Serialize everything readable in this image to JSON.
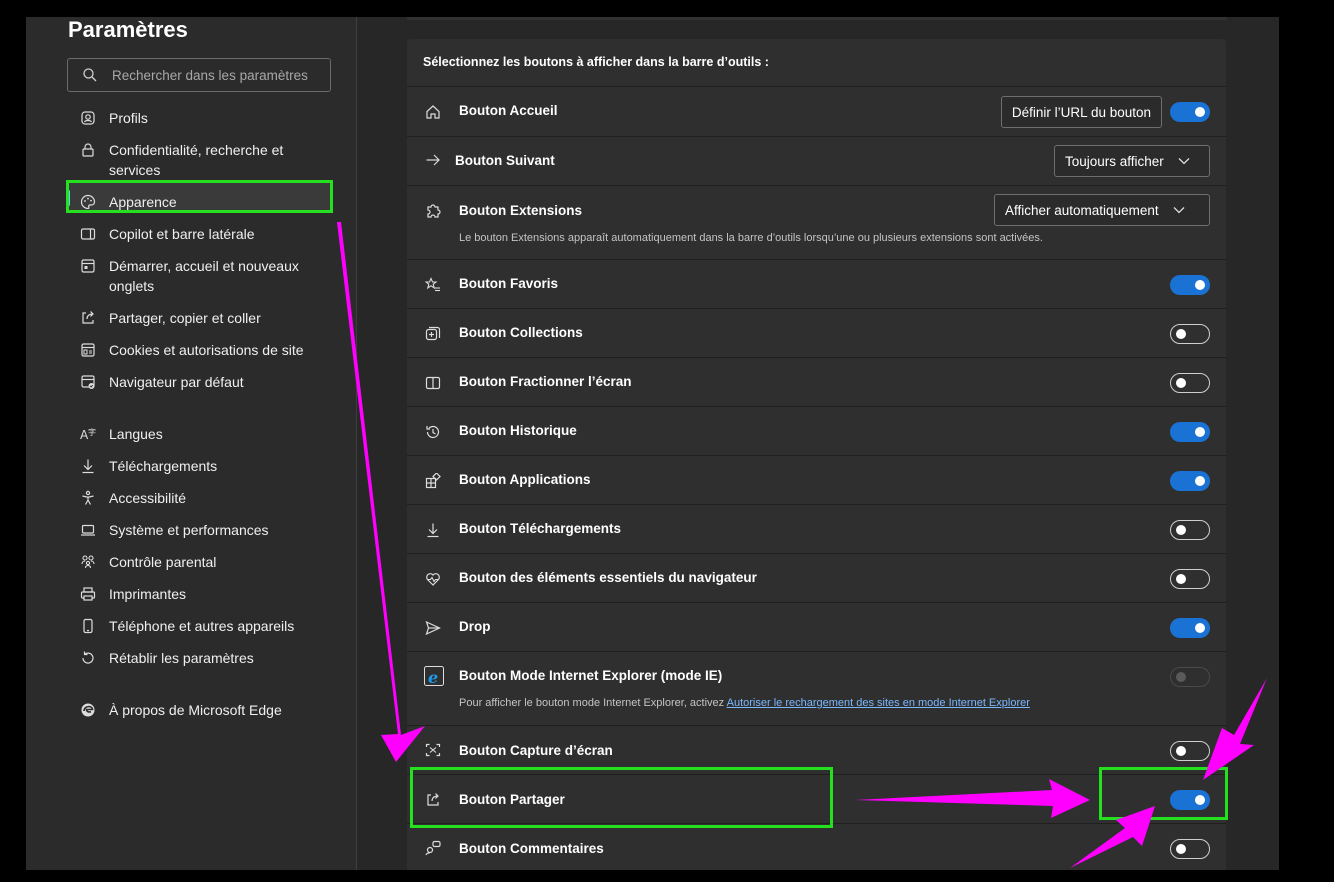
{
  "sidebar": {
    "title": "Paramètres",
    "search_placeholder": "Rechercher dans les paramètres",
    "items": [
      {
        "label": "Profils",
        "icon": "profile-icon"
      },
      {
        "label": "Confidentialité, recherche et services",
        "icon": "lock-icon"
      },
      {
        "label": "Apparence",
        "icon": "palette-icon",
        "active": true
      },
      {
        "label": "Copilot et barre latérale",
        "icon": "sidebar-icon"
      },
      {
        "label": "Démarrer, accueil et nouveaux onglets",
        "icon": "new-tab-icon"
      },
      {
        "label": "Partager, copier et coller",
        "icon": "share-icon"
      },
      {
        "label": "Cookies et autorisations de site",
        "icon": "cookie-icon"
      },
      {
        "label": "Navigateur par défaut",
        "icon": "default-browser-icon"
      },
      {
        "label": "Langues",
        "icon": "language-icon"
      },
      {
        "label": "Téléchargements",
        "icon": "download-icon"
      },
      {
        "label": "Accessibilité",
        "icon": "accessibility-icon"
      },
      {
        "label": "Système et performances",
        "icon": "laptop-icon"
      },
      {
        "label": "Contrôle parental",
        "icon": "family-icon"
      },
      {
        "label": "Imprimantes",
        "icon": "printer-icon"
      },
      {
        "label": "Téléphone et autres appareils",
        "icon": "phone-icon"
      },
      {
        "label": "Rétablir les paramètres",
        "icon": "reset-icon"
      },
      {
        "label": "À propos de Microsoft Edge",
        "icon": "edge-icon"
      }
    ]
  },
  "main": {
    "section_title": "Sélectionnez les boutons à afficher dans la barre d’outils :",
    "rows": [
      {
        "label": "Bouton Accueil",
        "icon": "home-icon",
        "button": "Définir l’URL du bouton",
        "toggle": "on"
      },
      {
        "label": "Bouton Suivant",
        "icon": "arrow-right-icon",
        "dropdown": "Toujours afficher"
      },
      {
        "label": "Bouton Extensions",
        "icon": "puzzle-icon",
        "dropdown": "Afficher automatiquement",
        "description": "Le bouton Extensions apparaît automatiquement dans la barre d’outils lorsqu’une ou plusieurs extensions sont activées."
      },
      {
        "label": "Bouton Favoris",
        "icon": "star-list-icon",
        "toggle": "on"
      },
      {
        "label": "Bouton Collections",
        "icon": "collections-icon",
        "toggle": "off"
      },
      {
        "label": "Bouton Fractionner l’écran",
        "icon": "split-screen-icon",
        "toggle": "off"
      },
      {
        "label": "Bouton Historique",
        "icon": "history-icon",
        "toggle": "on"
      },
      {
        "label": "Bouton Applications",
        "icon": "apps-icon",
        "toggle": "on"
      },
      {
        "label": "Bouton Téléchargements",
        "icon": "download-icon",
        "toggle": "off"
      },
      {
        "label": "Bouton des éléments essentiels du navigateur",
        "icon": "heart-pulse-icon",
        "toggle": "off"
      },
      {
        "label": "Drop",
        "icon": "send-icon",
        "toggle": "on"
      },
      {
        "label": "Bouton Mode Internet Explorer (mode IE)",
        "icon": "ie-icon",
        "toggle": "disabled",
        "description": "Pour afficher le bouton mode Internet Explorer, activez ",
        "link": "Autoriser le rechargement des sites en mode Internet Explorer"
      },
      {
        "label": "Bouton Capture d’écran",
        "icon": "screenshot-icon",
        "toggle": "off"
      },
      {
        "label": "Bouton Partager",
        "icon": "share-icon",
        "toggle": "on"
      },
      {
        "label": "Bouton Commentaires",
        "icon": "feedback-icon",
        "toggle": "off"
      }
    ]
  },
  "colors": {
    "accent": "#1a73d4",
    "highlight": "#24e01f",
    "arrow": "#ff00ff",
    "link": "#7ab8ff"
  }
}
